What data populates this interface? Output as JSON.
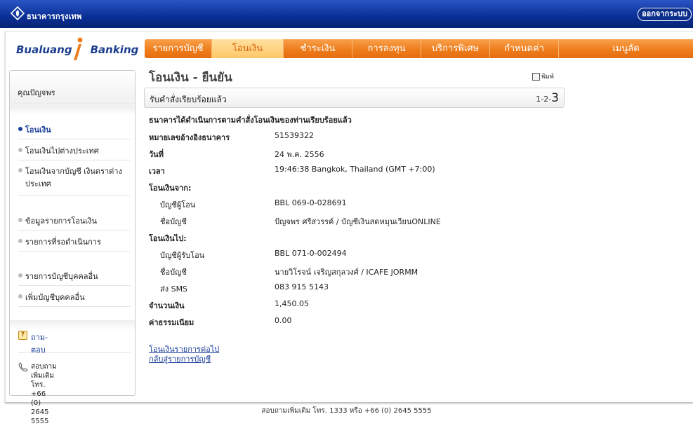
{
  "header": {
    "bank_name": "ธนาคารกรุงเทพ",
    "logout": "ออกจากระบบ"
  },
  "brand": {
    "part1": "Bualuang",
    "part2": "Banking"
  },
  "nav": {
    "items": [
      "รายการบัญชี",
      "โอนเงิน",
      "ชำระเงิน",
      "การลงทุน",
      "บริการพิเศษ",
      "กำหนดค่า",
      "เมนูลัด"
    ],
    "active": "โอนเงิน"
  },
  "sidebar": {
    "user": "คุณปัญจพร",
    "items": [
      "โอนเงิน",
      "โอนเงินไปต่างประเทศ",
      "โอนเงินจากบัญชี เงินตราต่างประเทศ",
      "ข้อมูลรายการโอนเงิน",
      "รายการที่รอดำเนินการ",
      "รายการบัญชีบุคคลอื่น",
      "เพิ่มบัญชีบุคคลอื่น"
    ],
    "faq": "ถาม-ตอบ",
    "contact_line1": "สอบถามเพิ่มเติม",
    "contact_line2": "โทร. +66 (0) 2645 5555"
  },
  "content": {
    "title": "โอนเงิน - ยืนยัน",
    "print": "พิมพ์",
    "status": "รับคำสั่งเรียบร้อยแล้ว",
    "step_prefix": "1-2-",
    "step_current": "3",
    "message": "ธนาคารได้ดำเนินการตามคำสั่งโอนเงินของท่านเรียบร้อยแล้ว",
    "ref_label": "หมายเลขอ้างอิงธนาคาร",
    "ref_value": "51539322",
    "date_label": "วันที่",
    "date_value": "24 พ.ค. 2556",
    "time_label": "เวลา",
    "time_value": "19:46:38 Bangkok, Thailand (GMT +7:00)",
    "from_heading": "โอนเงินจาก:",
    "from_account_label": "บัญชีผู้โอน",
    "from_account_value": "BBL 069-0-028691",
    "from_name_label": "ชื่อบัญชี",
    "from_name_value": "ปัญจพร ศรีสวรรค์ / บัญชีเงินสดหมุนเวียนONLINE",
    "to_heading": "โอนเงินไป:",
    "to_account_label": "บัญชีผู้รับโอน",
    "to_account_value": "BBL 071-0-002494",
    "to_name_label": "ชื่อบัญชี",
    "to_name_value": "นายวิโรจน์ เจริญสกุลวงศ์ / ICAFE JORMM",
    "sms_label": "ส่ง SMS",
    "sms_value": "083 915 5143",
    "amount_label": "จำนวนเงิน",
    "amount_value": "1,450.05",
    "fee_label": "ค่าธรรมเนียม",
    "fee_value": "0.00",
    "link_next": "โอนเงินรายการต่อไป",
    "link_back": "กลับสู่รายการบัญชี"
  },
  "footer": "สอบถามเพิ่มเติม โทร. 1333 หรือ +66 (0) 2645 5555"
}
